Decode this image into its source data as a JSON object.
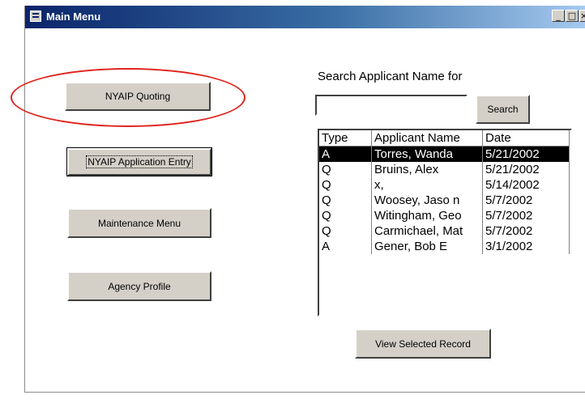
{
  "window": {
    "title": "Main Menu",
    "controls": {
      "minimize": "_",
      "maximize": "□",
      "close": "×"
    }
  },
  "menu": {
    "quoting_label": "NYAIP Quoting",
    "app_entry_label": "NYAIP Application Entry",
    "maintenance_label": "Maintenance Menu",
    "agency_label": "Agency Profile"
  },
  "search": {
    "label": "Search Applicant Name for",
    "value": "",
    "button_label": "Search"
  },
  "results": {
    "headers": [
      "Type",
      "Applicant Name",
      "Date"
    ],
    "rows": [
      [
        "A",
        "Torres, Wanda",
        "5/21/2002"
      ],
      [
        "Q",
        "Bruins, Alex",
        "5/21/2002"
      ],
      [
        "Q",
        "x,",
        "5/14/2002"
      ],
      [
        "Q",
        "Woosey, Jaso n",
        "5/7/2002"
      ],
      [
        "Q",
        "Witingham, Geo",
        "5/7/2002"
      ],
      [
        "Q",
        "Carmichael, Mat",
        "5/7/2002"
      ],
      [
        "A",
        "Gener, Bob E",
        "3/1/2002"
      ]
    ],
    "selected_row": 0
  },
  "view_button_label": "View Selected Record",
  "colors": {
    "titlebar_start": "#0a246a",
    "titlebar_end": "#a6caf0",
    "button_face": "#d4d0c8",
    "annotation_ellipse": "#e0231c",
    "selection": "#000000"
  }
}
